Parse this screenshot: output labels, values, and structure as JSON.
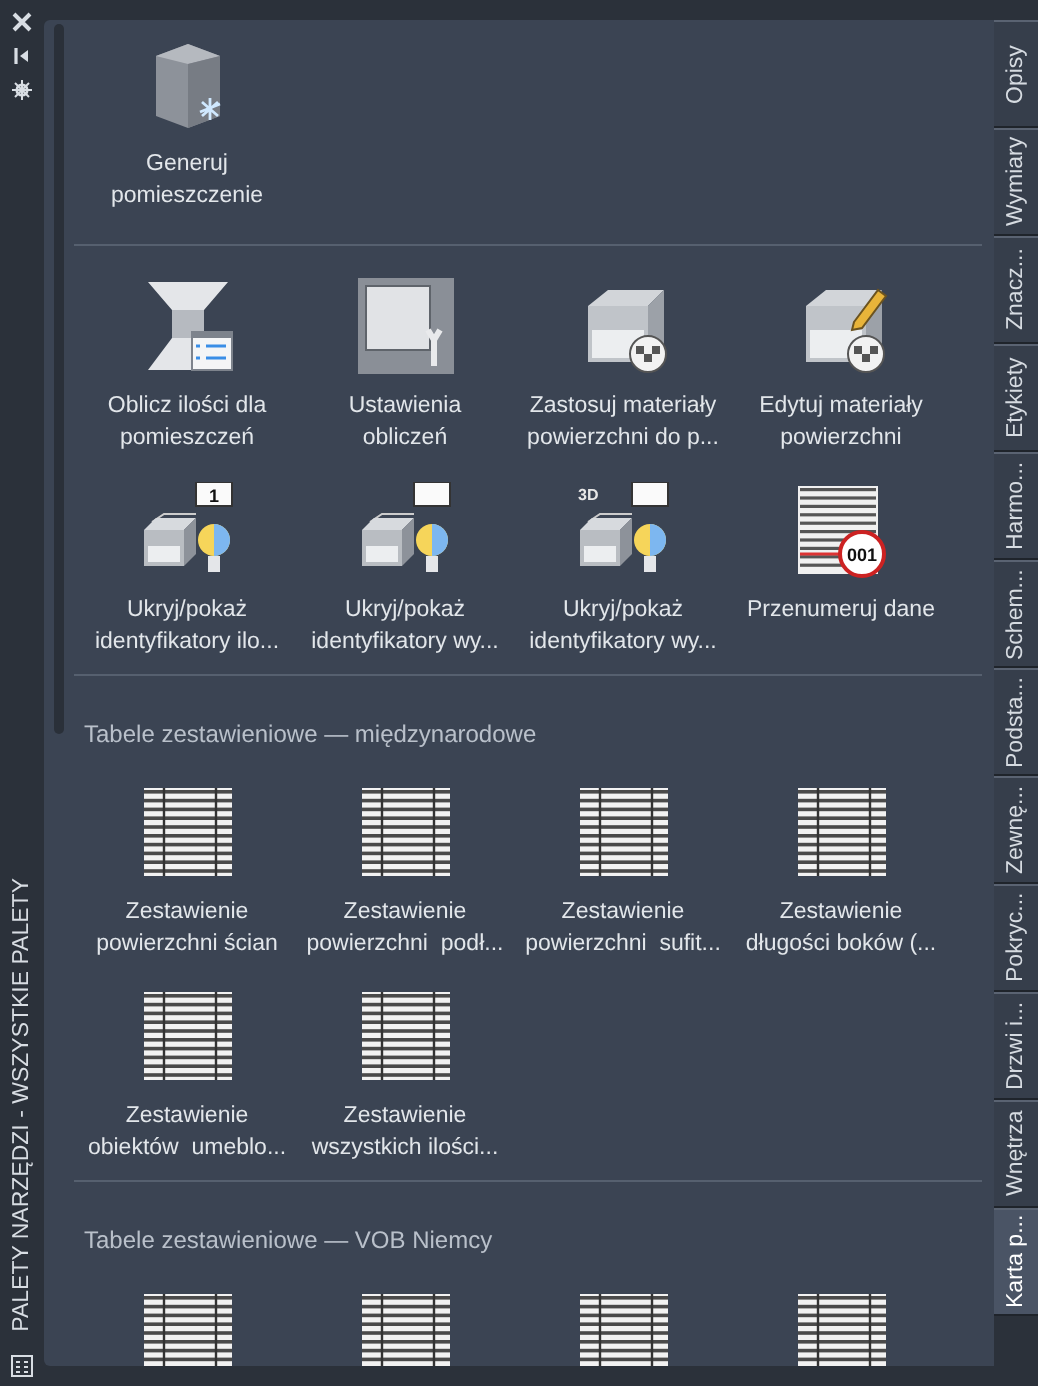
{
  "left_strip": {
    "title": "PALETY NARZĘDZI - WSZYSTKIE PALETY"
  },
  "sections": [
    {
      "items": [
        {
          "kind": "room",
          "label": "Generuj\npomieszczenie"
        }
      ]
    },
    {
      "items": [
        {
          "kind": "calculate",
          "label": "Oblicz ilości dla\npomieszczeń"
        },
        {
          "kind": "settings",
          "label": "Ustawienia\nobliczeń"
        },
        {
          "kind": "apply-material",
          "label": "Zastosuj materiały\npowierzchni do p..."
        },
        {
          "kind": "edit-material",
          "label": "Edytuj materiały\npowierzchni"
        },
        {
          "kind": "tag",
          "badge": "1",
          "label": "Ukryj/pokaż\nidentyfikatory ilo..."
        },
        {
          "kind": "tag",
          "label": "Ukryj/pokaż\nidentyfikatory wy..."
        },
        {
          "kind": "tag-3d",
          "badge": "3D",
          "label": "Ukryj/pokaż\nidentyfikatory wy..."
        },
        {
          "kind": "renumber",
          "badge": "001",
          "label": "Przenumeruj dane"
        }
      ]
    },
    {
      "title": "Tabele zestawieniowe — międzynarodowe",
      "items": [
        {
          "kind": "table",
          "label": "Zestawienie\npowierzchni ścian"
        },
        {
          "kind": "table",
          "label": "Zestawienie\npowierzchni  podł..."
        },
        {
          "kind": "table",
          "label": "Zestawienie\npowierzchni  sufit..."
        },
        {
          "kind": "table",
          "label": "Zestawienie\ndługości boków (..."
        },
        {
          "kind": "table",
          "label": "Zestawienie\nobiektów  umeblo..."
        },
        {
          "kind": "table",
          "label": "Zestawienie\nwszystkich ilości..."
        }
      ]
    },
    {
      "title": "Tabele zestawieniowe — VOB Niemcy",
      "items": [
        {
          "kind": "table"
        },
        {
          "kind": "table"
        },
        {
          "kind": "table"
        },
        {
          "kind": "table"
        }
      ]
    }
  ],
  "tabs": [
    {
      "label": "Opisy",
      "selected": false
    },
    {
      "label": "Wymiary",
      "selected": false
    },
    {
      "label": "Znacz...",
      "selected": false
    },
    {
      "label": "Etykiety",
      "selected": false
    },
    {
      "label": "Harmo...",
      "selected": false
    },
    {
      "label": "Schem...",
      "selected": false
    },
    {
      "label": "Podsta...",
      "selected": false
    },
    {
      "label": "Zewnę...",
      "selected": false
    },
    {
      "label": "Pokryc...",
      "selected": false
    },
    {
      "label": "Drzwi i...",
      "selected": false
    },
    {
      "label": "Wnętrza",
      "selected": false
    },
    {
      "label": "Karta p...",
      "selected": true
    }
  ]
}
